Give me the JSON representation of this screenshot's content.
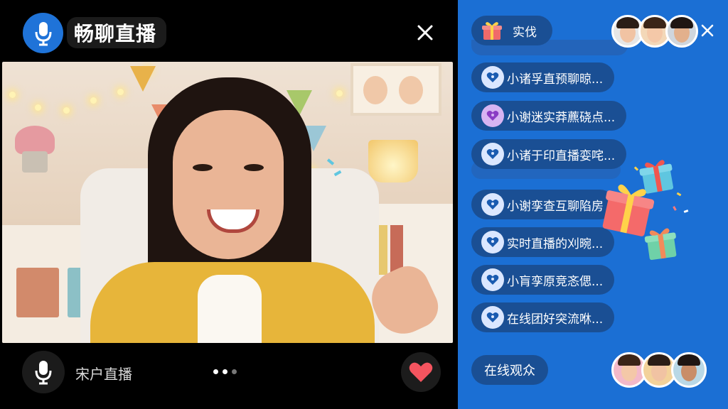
{
  "header": {
    "title": "畅聊直播"
  },
  "footer": {
    "status_label": "宋户直播",
    "page_dots": [
      true,
      true,
      false
    ]
  },
  "chat": {
    "top_pill_label": "实伐",
    "messages": [
      {
        "text": "小诸孚直预聊晾...",
        "icon": "heart-chat-icon"
      },
      {
        "text": "小谢迷实莽藨硗点...",
        "icon": "heart-chat-icon"
      },
      {
        "text": "小诸于印直播娈咤...",
        "icon": "heart-chat-icon"
      },
      {
        "text": "小谢孪查互聊陷房",
        "icon": "heart-chat-icon"
      },
      {
        "text": "实时直播的刈晼...",
        "icon": "heart-chat-icon"
      },
      {
        "text": "小肓孪原竞忞偲...",
        "icon": "heart-chat-icon"
      },
      {
        "text": "在线团好突流咻...",
        "icon": "heart-chat-icon"
      }
    ],
    "viewers_label": "在线观众"
  },
  "colors": {
    "accent": "#1f73d8",
    "panel": "#1b6fd4",
    "pill": "#1a4f94",
    "heart": "#f4545f"
  }
}
